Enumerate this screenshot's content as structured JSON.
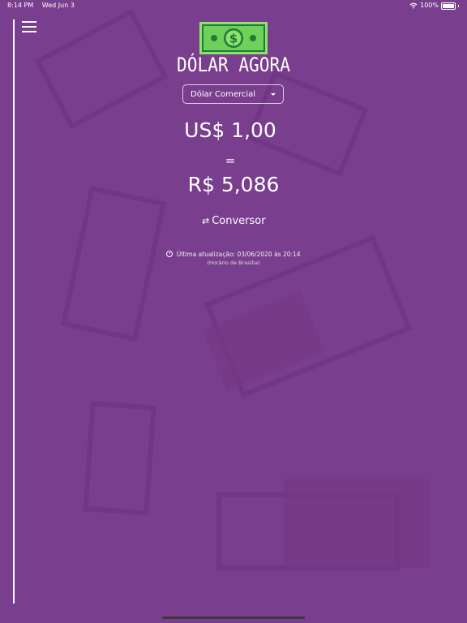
{
  "status_bar": {
    "time": "8:14 PM",
    "date": "Wed Jun 3",
    "battery": "100%",
    "wifi_icon": "wifi-icon",
    "battery_icon": "battery-icon"
  },
  "header": {
    "menu_icon": "hamburger-icon",
    "logo_icon": "dollar-bill-icon",
    "title": "DÓLAR AGORA"
  },
  "currency_select": {
    "selected": "Dólar Comercial"
  },
  "rate": {
    "usd": "US$ 1,00",
    "equals": "=",
    "brl": "R$ 5,086"
  },
  "converter": {
    "icon": "swap-arrows-icon",
    "label": "Conversor"
  },
  "last_update": {
    "icon": "clock-icon",
    "text": "Última atualização: 03/06/2020 às 20:14",
    "timezone": "(Horário de Brasília)"
  },
  "colors": {
    "background": "#7a3e8e",
    "logo_green": "#8ee26b",
    "logo_dark": "#1f7a3c"
  }
}
